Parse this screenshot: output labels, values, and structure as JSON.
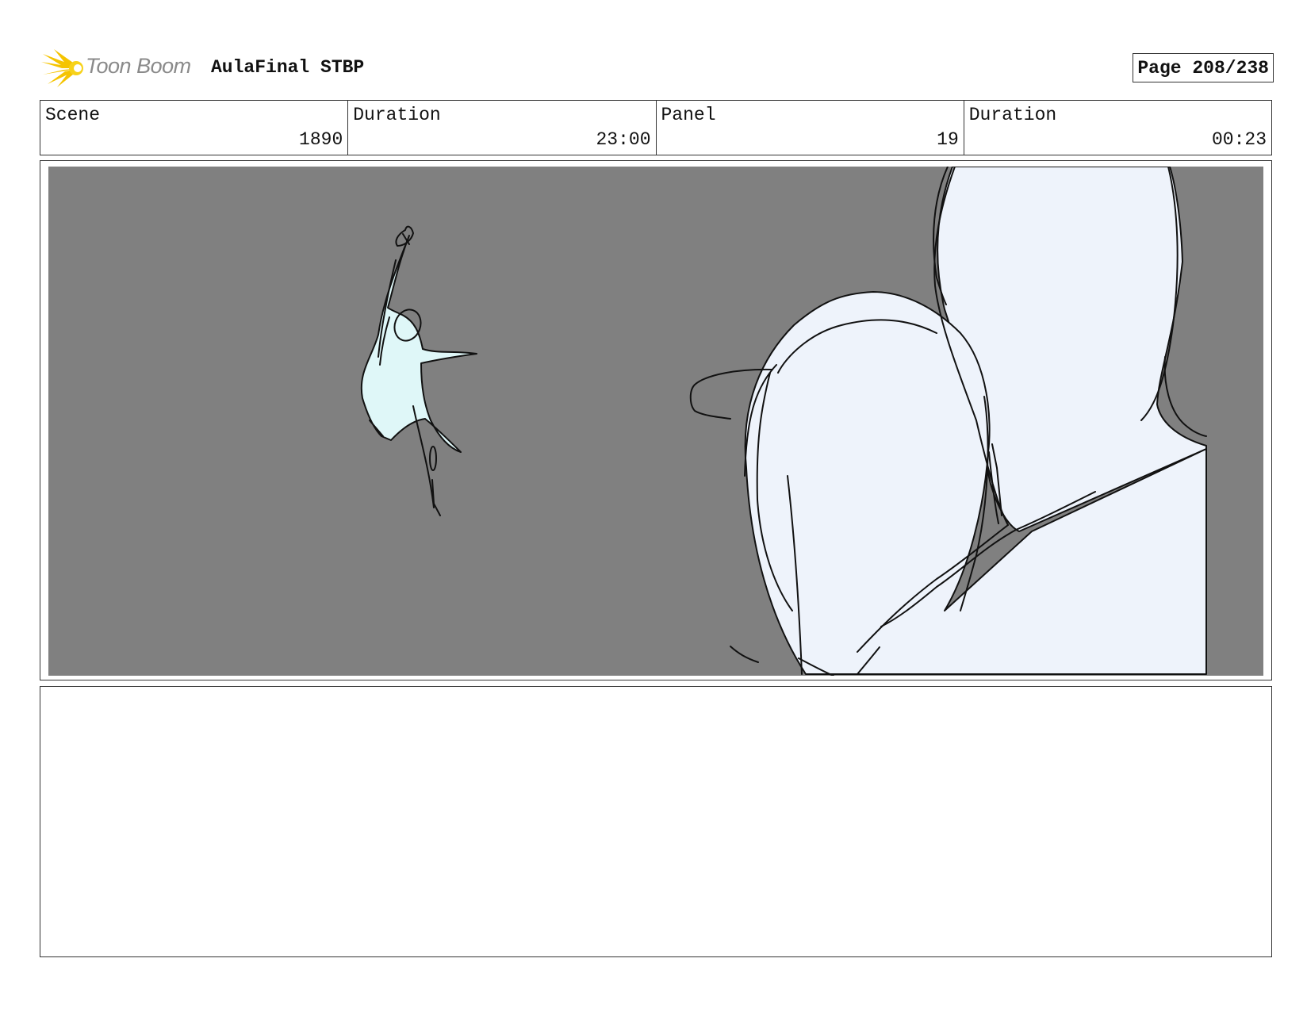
{
  "header": {
    "logo_text": "Toon Boom",
    "project_title": "AulaFinal STBP",
    "page_indicator": "Page 208/238"
  },
  "info": [
    {
      "label": "Scene",
      "value": "1890"
    },
    {
      "label": "Duration",
      "value": "23:00"
    },
    {
      "label": "Panel",
      "value": "19"
    },
    {
      "label": "Duration",
      "value": "00:23"
    }
  ],
  "panel": {
    "background_color": "#808080",
    "figure_fill": "#dff7f8",
    "character_fill": "#eef3fb",
    "line_color": "#111111"
  },
  "notes": {
    "text": ""
  },
  "colors": {
    "logo_flare": "#f5c400",
    "border": "#333333"
  }
}
